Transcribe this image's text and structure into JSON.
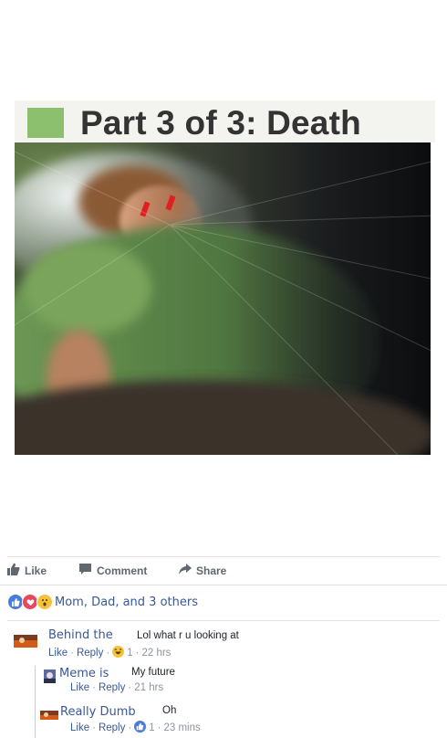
{
  "post": {
    "meme_title": "Part 3 of 3: Death"
  },
  "actions": {
    "like": "Like",
    "comment": "Comment",
    "share": "Share"
  },
  "reactions": {
    "names": "Mom, Dad, and 3 others",
    "icons": [
      "like-reaction",
      "love-reaction",
      "wow-reaction"
    ]
  },
  "comments": [
    {
      "name": "Behind the",
      "text": "Lol what r u looking at",
      "like": "Like",
      "reply": "Reply",
      "reaction_count": "1",
      "time": "22 hrs"
    },
    {
      "name": "Meme is",
      "text": "My future",
      "like": "Like",
      "reply": "Reply",
      "time": "21 hrs"
    },
    {
      "name": "Really Dumb",
      "text": "Oh",
      "like": "Like",
      "reply": "Reply",
      "reaction_count": "1",
      "time": "23 mins"
    }
  ],
  "colors": {
    "link": "#385898",
    "meta": "#90949c",
    "action": "#606770",
    "green_square": "#8cc06f"
  }
}
